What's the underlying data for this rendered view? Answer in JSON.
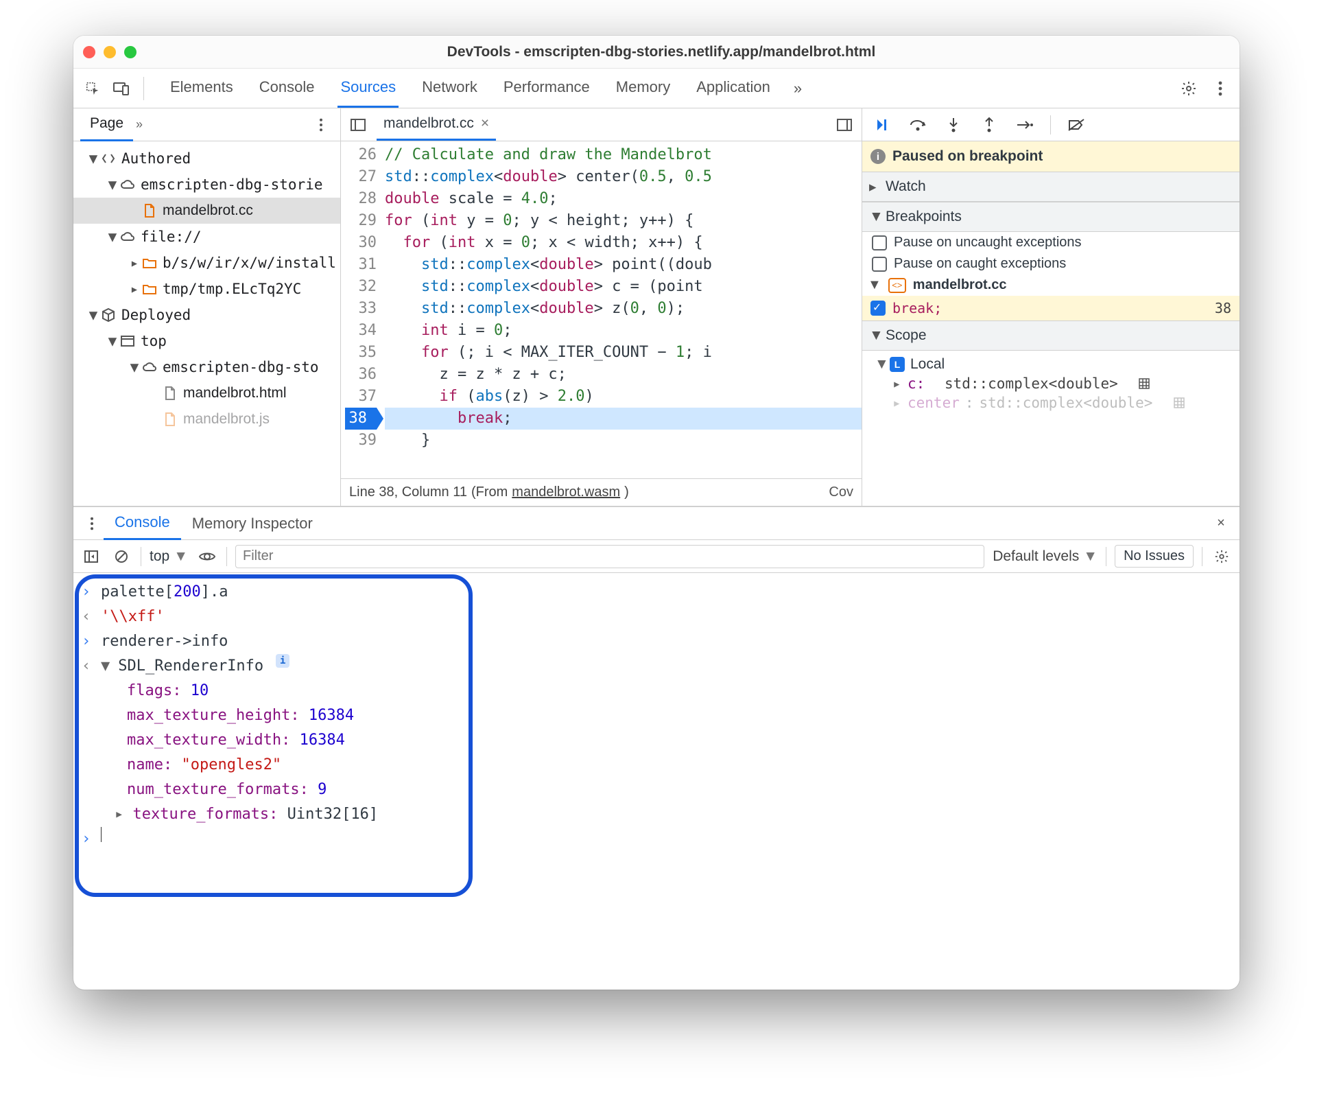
{
  "window": {
    "title": "DevTools - emscripten-dbg-stories.netlify.app/mandelbrot.html"
  },
  "main_tabs": {
    "items": [
      "Elements",
      "Console",
      "Sources",
      "Network",
      "Performance",
      "Memory",
      "Application"
    ],
    "more_glyph": "»",
    "active_index": 2
  },
  "nav": {
    "tab": "Page",
    "more_glyph": "»",
    "authored": "Authored",
    "site": "emscripten-dbg-storie",
    "file": "mandelbrot.cc",
    "file_scheme": "file://",
    "folder1": "b/s/w/ir/x/w/install",
    "folder2": "tmp/tmp.ELcTq2YC",
    "deployed": "Deployed",
    "top": "top",
    "site2": "emscripten-dbg-sto",
    "html": "mandelbrot.html",
    "js": "mandelbrot.js"
  },
  "editor": {
    "filename": "mandelbrot.cc",
    "first_line_no": 26,
    "lines": [
      "// Calculate and draw the Mandelbrot",
      "std::complex<double> center(0.5, 0.5",
      "double scale = 4.0;",
      "for (int y = 0; y < height; y++) {",
      "  for (int x = 0; x < width; x++) {",
      "    std::complex<double> point((doub",
      "    std::complex<double> c = (point ",
      "    std::complex<double> z(0, 0);",
      "    int i = 0;",
      "    for (; i < MAX_ITER_COUNT − 1; i",
      "      z = z * z + c;",
      "      if (abs(z) > 2.0)",
      "        break;",
      "    }"
    ],
    "bp_line": 38,
    "status_left": "Line 38, Column 11 ",
    "status_from": "(From ",
    "status_link": "mandelbrot.wasm",
    "status_close": ")",
    "status_right": "Cov"
  },
  "debugger": {
    "paused": "Paused on breakpoint",
    "watch": "Watch",
    "breakpoints": "Breakpoints",
    "uncaught": "Pause on uncaught exceptions",
    "caught": "Pause on caught exceptions",
    "bp_file": "mandelbrot.cc",
    "bp_text": "break;",
    "bp_lineno": "38",
    "scope": "Scope",
    "local": "Local",
    "var_c_name": "c:",
    "var_c_type": "std::complex<double>",
    "var2_name": "center",
    "var2_type": "std::complex<double>"
  },
  "drawer": {
    "tabs": [
      "Console",
      "Memory Inspector"
    ],
    "active_index": 0
  },
  "console": {
    "context": "top",
    "filter_placeholder": "Filter",
    "levels": "Default levels",
    "no_issues": "No Issues",
    "entries": {
      "e0_in": "palette[200].a",
      "e0_out": "'\\\\xff'",
      "e1_in": "renderer->info",
      "e1_type": "SDL_RendererInfo",
      "flags_key": "flags:",
      "flags_val": "10",
      "mth_key": "max_texture_height:",
      "mth_val": "16384",
      "mtw_key": "max_texture_width:",
      "mtw_val": "16384",
      "name_key": "name:",
      "name_val": "\"opengles2\"",
      "ntf_key": "num_texture_formats:",
      "ntf_val": "9",
      "tf_key": "texture_formats:",
      "tf_val": "Uint32[16]"
    }
  }
}
